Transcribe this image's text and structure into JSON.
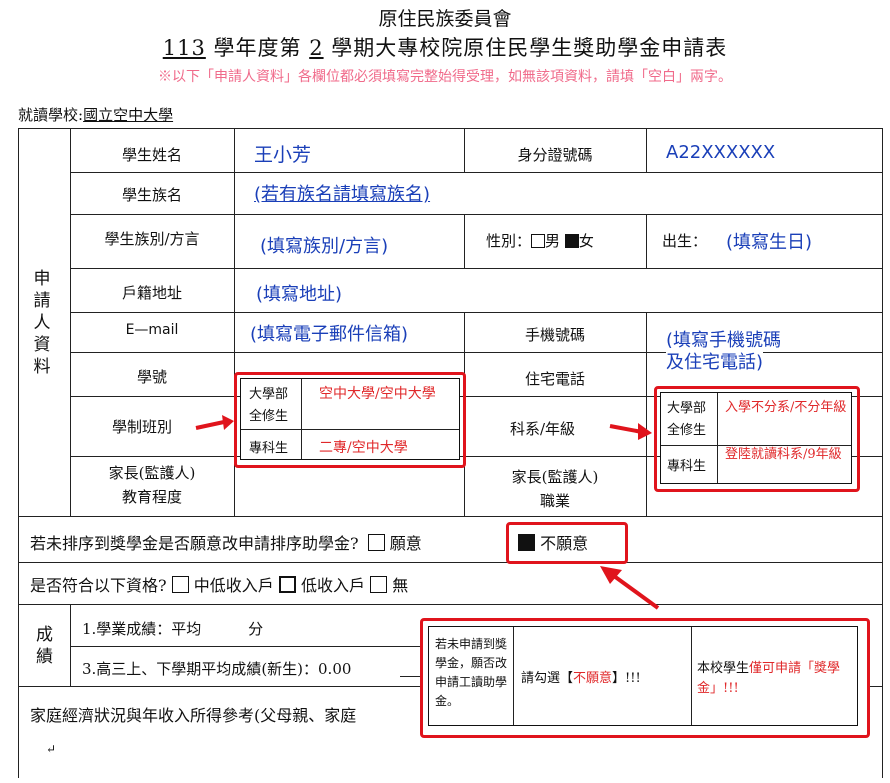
{
  "header": {
    "agency": "原住民族委員會",
    "year": "113",
    "title_part1": "學年度第",
    "semester": "2",
    "title_part2": "學期大專校院原住民學生獎助學金申請表",
    "notice": "※以下「申請人資料」各欄位都必須填寫完整始得受理，如無該項資料，請填「空白」兩字。"
  },
  "school": {
    "label": "就讀學校:",
    "value": "國立空中大學"
  },
  "side_label": "申請人資料",
  "rows": {
    "name_label": "學生姓名",
    "name_value": "王小芳",
    "id_label": "身分證號碼",
    "id_value": "A22XXXXXX",
    "tribe_label": "學生族名",
    "tribe_value": "(若有族名請填寫族名)",
    "dialect_label": "學生族別/方言",
    "dialect_value": "(填寫族別/方言)",
    "gender_label": "性別：",
    "gender_male": "男",
    "gender_female": "女",
    "birth_label": "出生：",
    "birth_value": "(填寫生日)",
    "address_label": "戶籍地址",
    "address_value": "(填寫地址)",
    "email_label": "E—mail",
    "email_value": "(填寫電子郵件信箱)",
    "mobile_label": "手機號碼",
    "mobile_value_1": "(填寫手機號碼",
    "mobile_value_2": "及住宅電話)",
    "student_no_label": "學號",
    "home_phone_label": "住宅電話",
    "program_label": "學制班別",
    "dept_label": "科系/年級",
    "parent_edu_label_1": "家長(監護人)",
    "parent_edu_label_2": "教育程度",
    "parent_job_label_1": "家長(監護人)",
    "parent_job_label_2": "職業"
  },
  "program_table": {
    "r1_label_1": "大學部",
    "r1_label_2": "全修生",
    "r1_value": "空中大學/空中大學",
    "r2_label": "專科生",
    "r2_value": "二專/空中大學"
  },
  "dept_table": {
    "r1_label_1": "大學部",
    "r1_label_2": "全修生",
    "r1_value": "入學不分系/不分年級",
    "r2_label": "專科生",
    "r2_value": "登陸就讀科系/9年級"
  },
  "question1": {
    "text": "若未排序到獎學金是否願意改申請排序助學金?",
    "opt_yes": "願意",
    "opt_no": "不願意"
  },
  "question2": {
    "text": "是否符合以下資格?",
    "opt1": "中低收入戶",
    "opt2": "低收入戶",
    "opt3": "無"
  },
  "grades": {
    "label": "成績",
    "line1_a": "1.學業成績：平均",
    "line1_b": "分",
    "line3": "3.高三上、下學期平均成績(新生)：0.00"
  },
  "family": {
    "text": "家庭經濟狀況與年收入所得參考(父母親、家庭"
  },
  "note_box": {
    "c1": "若未申請到獎學金，願否改申請工讀助學金。",
    "c2_a": "請勾選【",
    "c2_b": "不願意",
    "c2_c": "】!!!",
    "c3_a": "本校學生",
    "c3_b": "僅可申請「獎學金」!!!"
  },
  "colors": {
    "blue": "#1a3fb8",
    "red": "#e0282a",
    "highlight": "#e0141c"
  }
}
